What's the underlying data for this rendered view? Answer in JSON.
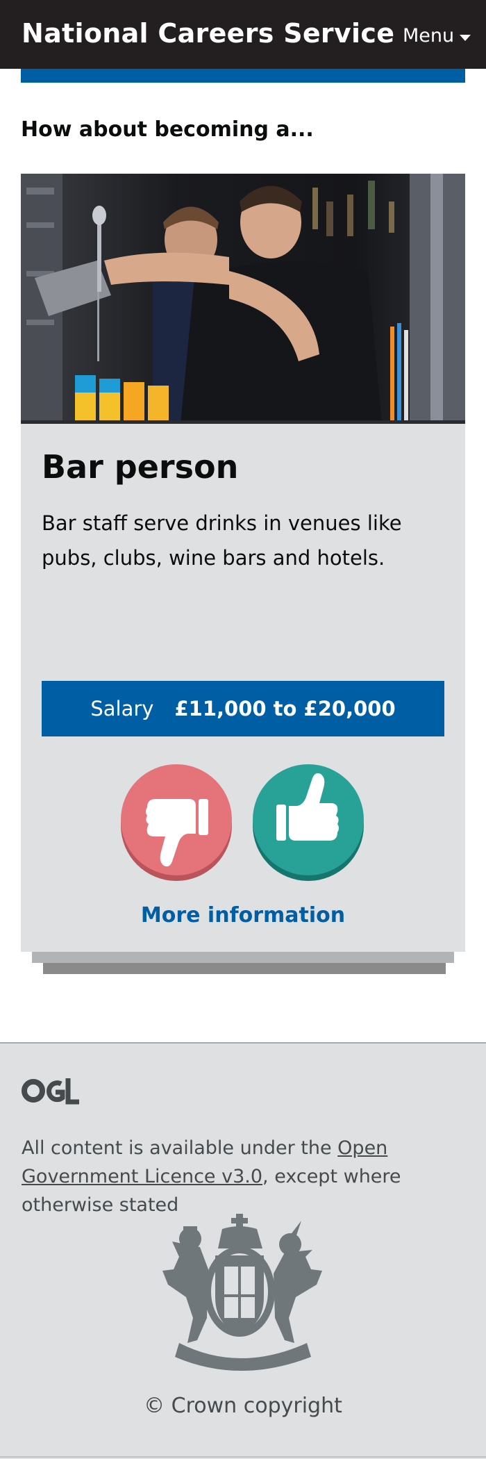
{
  "header": {
    "brand": "National Careers Service",
    "menu_label": "Menu",
    "background": "#231f20"
  },
  "main": {
    "heading": "How about becoming a..."
  },
  "card": {
    "image_description_icon": "bartender-photo",
    "title": "Bar person",
    "description": "Bar staff serve drinks in venues like pubs, clubs, wine bars and hotels.",
    "salary_label": "Salary",
    "salary_value": "£11,000 to £20,000",
    "dislike_icon": "thumbs-down-icon",
    "like_icon": "thumbs-up-icon",
    "more_info_label": "More information",
    "colors": {
      "accent_blue": "#005ea5",
      "dislike_red": "#e5737a",
      "like_teal": "#28a197",
      "card_bg": "#dee0e2"
    }
  },
  "footer": {
    "ogl_logo_text": "OGL",
    "licence_prefix": "All content is available under the ",
    "licence_link": "Open Government Licence v3.0",
    "licence_suffix": ", except where otherwise stated",
    "crest_icon": "royal-coat-of-arms-icon",
    "copyright": "© Crown copyright"
  }
}
